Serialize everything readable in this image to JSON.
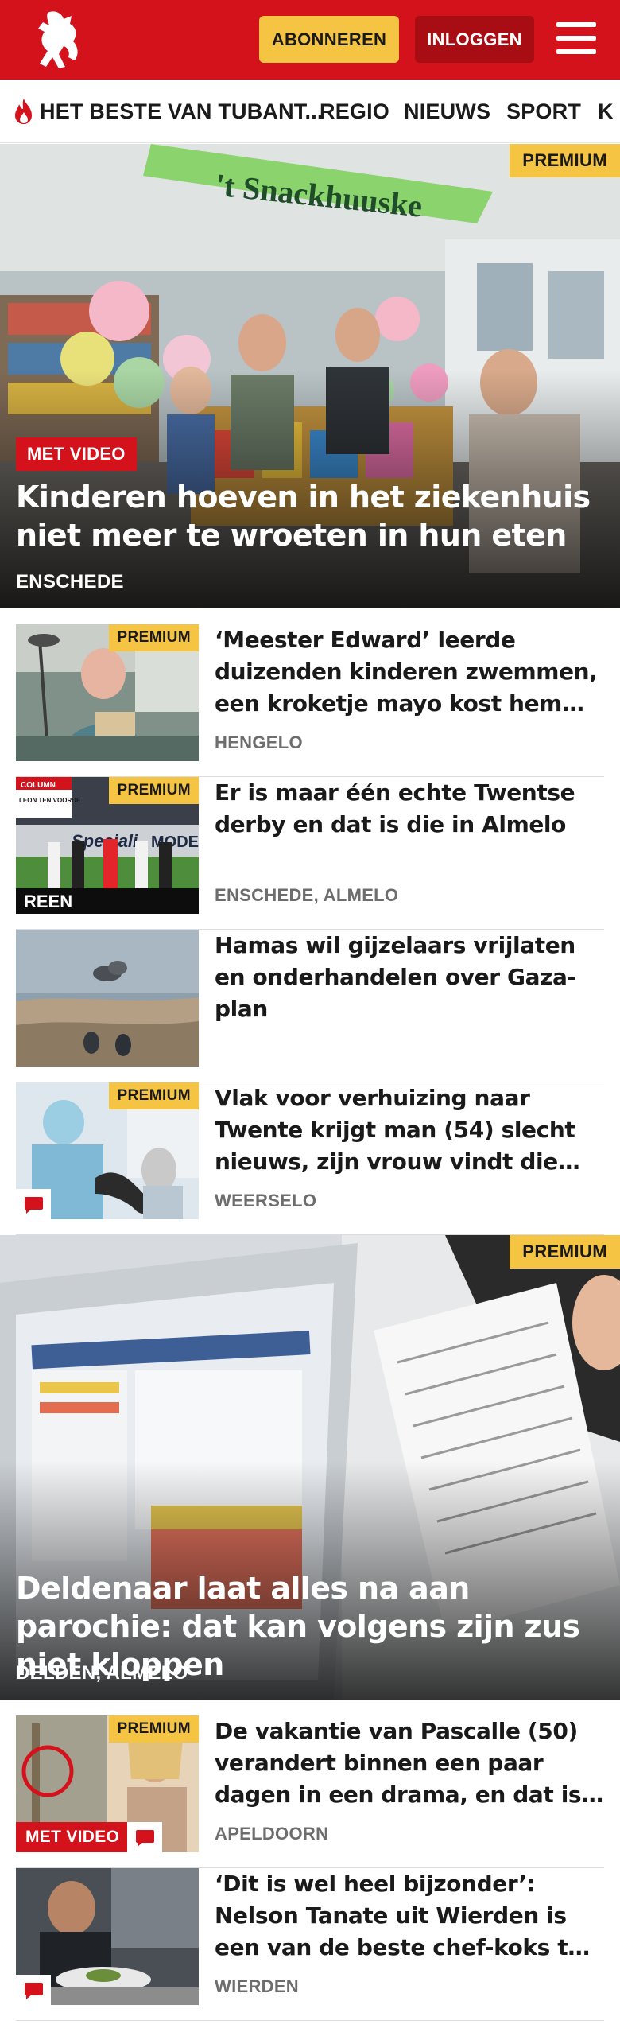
{
  "header": {
    "subscribe_label": "ABONNEREN",
    "login_label": "INLOGGEN",
    "brand_color": "#d3121b",
    "subscribe_color": "#f6c443"
  },
  "nav": {
    "items": [
      "HET BESTE VAN TUBANT...",
      "REGIO",
      "NIEUWS",
      "SPORT",
      "K"
    ]
  },
  "hero1": {
    "badge": "PREMIUM",
    "video": "MET VIDEO",
    "title": "Kinderen hoeven in het ziekenhuis niet meer te wroeten in hun eten",
    "location": "ENSCHEDE",
    "banner_text": "'t Snackhuuske"
  },
  "articles": [
    {
      "badge": "PREMIUM",
      "title": "‘Meester Edward’ leerde duizenden kinderen zwemmen, een kroketje mayo kost hem nu…",
      "location": "HENGELO"
    },
    {
      "badge": "PREMIUM",
      "title": "Er is maar één echte Twentse derby en dat is die in Almelo",
      "location": "ENSCHEDE, ALMELO",
      "column_label": "COLUMN",
      "column_author": "LEON TEN VOORDE"
    },
    {
      "title": "Hamas wil gijzelaars vrijlaten en onderhandelen over Gaza-plan",
      "location": ""
    },
    {
      "badge": "PREMIUM",
      "title": "Vlak voor verhuizing naar Twente krijgt man (54) slecht nieuws, zijn vrouw vindt die diagnose te…",
      "location": "WEERSELO"
    }
  ],
  "hero2": {
    "badge": "PREMIUM",
    "title": "Deldenaar laat alles na aan parochie: dat kan volgens zijn zus niet kloppen",
    "location": "DELDEN, ALMELO"
  },
  "articles2": [
    {
      "badge": "PREMIUM",
      "video": "MET VIDEO",
      "title": "De vakantie van Pascalle (50) verandert binnen een paar dagen in een drama, en dat is niet voor…",
      "location": "APELDOORN"
    },
    {
      "title": "‘Dit is wel heel bijzonder’: Nelson Tanate uit Wierden is een van de beste chef-koks ter wereld",
      "location": "WIERDEN"
    }
  ]
}
